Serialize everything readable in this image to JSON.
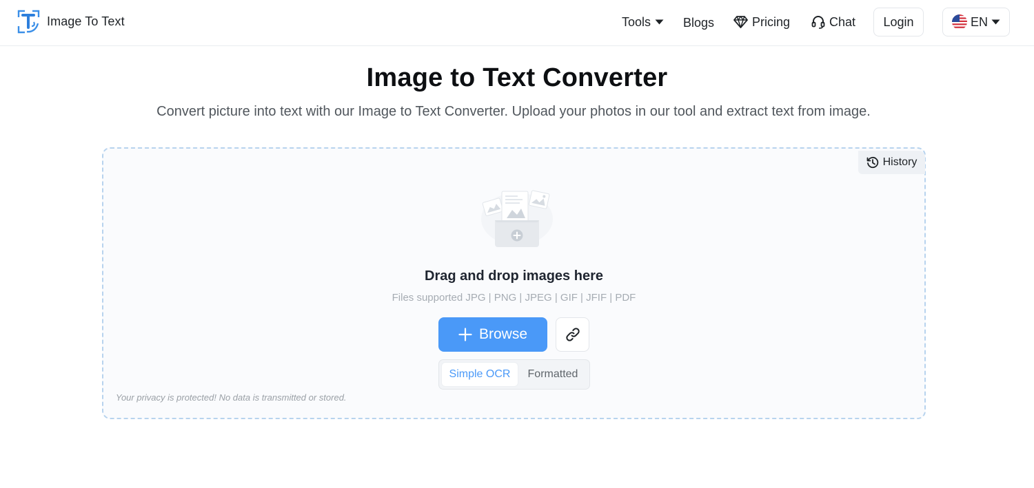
{
  "header": {
    "brand_name": "Image To Text",
    "nav": {
      "tools": "Tools",
      "blogs": "Blogs",
      "pricing": "Pricing",
      "chat": "Chat",
      "login": "Login",
      "language": "EN"
    }
  },
  "hero": {
    "title": "Image to Text Converter",
    "subtitle": "Convert picture into text with our Image to Text Converter. Upload your photos in our tool and extract text from image."
  },
  "upload": {
    "history_label": "History",
    "drop_title": "Drag and drop images here",
    "formats": "Files supported JPG | PNG | JPEG | GIF | JFIF | PDF",
    "browse_label": "Browse",
    "modes": [
      {
        "label": "Simple OCR",
        "active": true
      },
      {
        "label": "Formatted",
        "active": false
      }
    ],
    "privacy": "Your privacy is protected! No data is transmitted or stored."
  },
  "colors": {
    "accent": "#4a99f8",
    "dropzone_border": "#b7d3ee",
    "dropzone_bg": "#fafbfd"
  },
  "icons": [
    "logo-icon",
    "caret-down-icon",
    "diamond-icon",
    "headset-icon",
    "us-flag-icon",
    "history-icon",
    "upload-illustration",
    "plus-icon",
    "link-icon"
  ]
}
